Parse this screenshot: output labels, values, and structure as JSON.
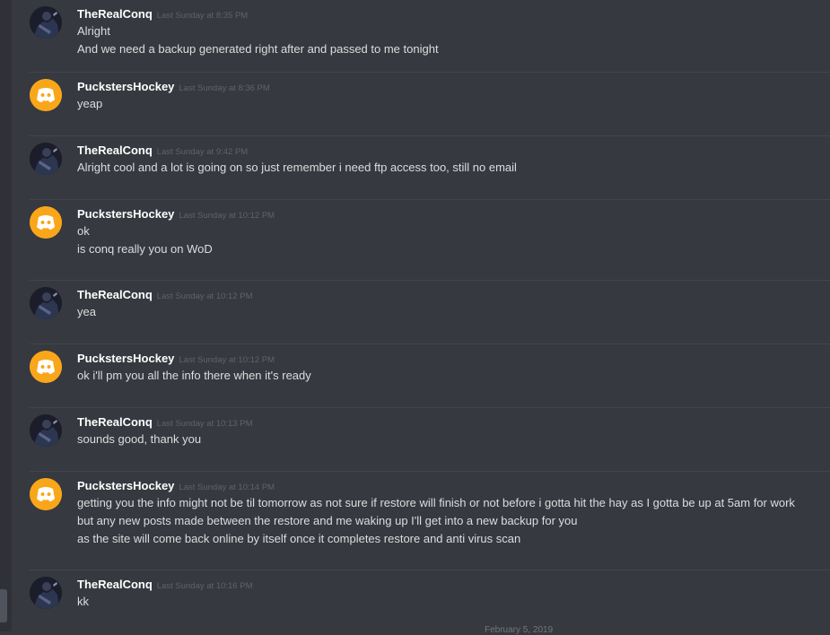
{
  "messages": [
    {
      "user": "TheRealConq",
      "avatar": "conq",
      "time": "Last Sunday at 8:35 PM",
      "lines": [
        "Alright",
        "And we need a backup generated right after and passed to me tonight"
      ]
    },
    {
      "user": "PuckstersHockey",
      "avatar": "puck",
      "time": "Last Sunday at 8:36 PM",
      "lines": [
        "yeap"
      ]
    },
    {
      "user": "TheRealConq",
      "avatar": "conq",
      "time": "Last Sunday at 9:42 PM",
      "lines": [
        "Alright cool and a lot is going on so just remember i need ftp access too, still no email"
      ]
    },
    {
      "user": "PuckstersHockey",
      "avatar": "puck",
      "time": "Last Sunday at 10:12 PM",
      "lines": [
        "ok",
        "is conq really you on WoD"
      ]
    },
    {
      "user": "TheRealConq",
      "avatar": "conq",
      "time": "Last Sunday at 10:12 PM",
      "lines": [
        "yea"
      ]
    },
    {
      "user": "PuckstersHockey",
      "avatar": "puck",
      "time": "Last Sunday at 10:12 PM",
      "lines": [
        "ok  i'll pm you all the info there when it's ready"
      ]
    },
    {
      "user": "TheRealConq",
      "avatar": "conq",
      "time": "Last Sunday at 10:13 PM",
      "lines": [
        "sounds good, thank you"
      ]
    },
    {
      "user": "PuckstersHockey",
      "avatar": "puck",
      "time": "Last Sunday at 10:14 PM",
      "lines": [
        "getting you the info might not be til tomorrow as not sure if restore will finish or not before i gotta hit the hay as I gotta be up at 5am for  work",
        "but any new posts made between the restore and me waking up I'll get into a new backup for you",
        "as the site will come back online by itself once it completes restore and anti virus scan"
      ]
    },
    {
      "user": "TheRealConq",
      "avatar": "conq",
      "time": "Last Sunday at 10:16 PM",
      "lines": [
        "kk"
      ]
    }
  ],
  "footer": {
    "date_hint": "February 5, 2019"
  },
  "colors": {
    "background": "#36393f",
    "username": "#ffffff",
    "timestamp": "#5f636a",
    "message_text": "#dcddde",
    "puck_avatar": "#faa61a"
  },
  "icons": {
    "conq_avatar": "dark-figure-avatar",
    "puck_avatar": "discord-default-avatar-icon"
  }
}
